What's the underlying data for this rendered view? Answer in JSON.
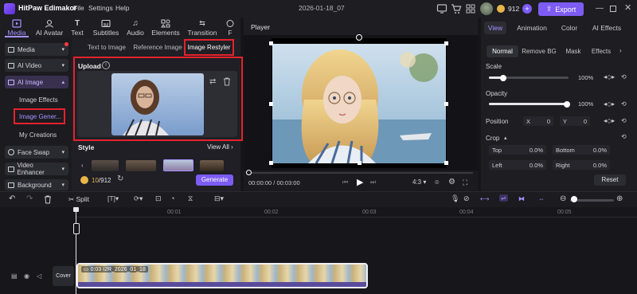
{
  "app": {
    "title": "HitPaw Edimakor",
    "menus": [
      "File",
      "Settings",
      "Help"
    ],
    "project": "2026-01-18_07",
    "credits": "912",
    "plus": "+",
    "export_label": "Export"
  },
  "toolbar": {
    "items": [
      "Media",
      "AI Avatar",
      "Text",
      "Subtitles",
      "Audio",
      "Elements",
      "Transition",
      "F"
    ]
  },
  "sidebar": {
    "items": [
      "Media",
      "AI Video",
      "AI Image",
      "Face Swap",
      "Video Enhancer",
      "Background"
    ],
    "subitems": [
      "Image Effects",
      "Image Gener...",
      "My Creations"
    ]
  },
  "panel": {
    "tabs": [
      "Text to Image",
      "Reference Image",
      "Image Restyler"
    ],
    "upload_label": "Upload",
    "info": "i",
    "style_label": "Style",
    "view_all": "View All",
    "credits_used": "10",
    "credits_total": "/912",
    "generate_label": "Generate"
  },
  "player": {
    "label": "Player",
    "time": "00:00:00 / 00:03:00",
    "ratio": "4:3"
  },
  "right": {
    "tabs": [
      "View",
      "Animation",
      "Color",
      "AI Effects"
    ],
    "subtabs": [
      "Normal",
      "Remove BG",
      "Mask",
      "Effects"
    ],
    "scale_label": "Scale",
    "scale_value": "100%",
    "opacity_label": "Opacity",
    "opacity_value": "100%",
    "position_label": "Position",
    "x_label": "X",
    "x_value": "0",
    "y_label": "Y",
    "y_value": "0",
    "crop_label": "Crop",
    "top_label": "Top",
    "top_value": "0.0%",
    "bottom_label": "Bottom",
    "bottom_value": "0.0%",
    "left_label": "Left",
    "left_value": "0.0%",
    "right_label": "Right",
    "right_value": "0.0%",
    "reset_label": "Reset",
    "scale_level": 1.0,
    "opacity_level": 1.0
  },
  "timeline": {
    "split_label": "Split",
    "ticks": [
      "00:01",
      "00:02",
      "00:03",
      "00:04",
      "00:05"
    ],
    "cover_label": "Cover",
    "clip_label": "0:03 I2R_2026_01_18"
  },
  "colors": {
    "accent": "#7c5cf3",
    "highlight": "#e5222c"
  }
}
